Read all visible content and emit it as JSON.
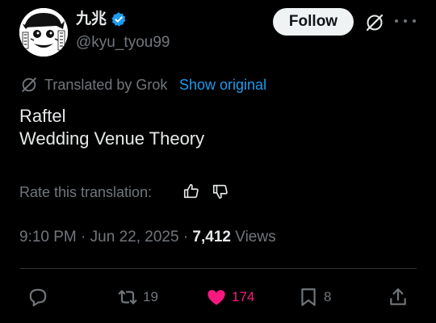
{
  "author": {
    "display_name": "九兆",
    "handle": "@kyu_tyou99",
    "verified": true
  },
  "header": {
    "follow_label": "Follow",
    "icons": [
      "grok-icon",
      "more-icon"
    ]
  },
  "translation": {
    "label": "Translated by Grok",
    "show_original": "Show original"
  },
  "tweet": {
    "lines": [
      "Raftel",
      "Wedding Venue Theory"
    ]
  },
  "rating": {
    "label": "Rate this translation:",
    "icons": [
      "thumbs-up-icon",
      "thumbs-down-icon"
    ]
  },
  "meta": {
    "time": "9:10 PM",
    "separator": " · ",
    "date": "Jun 22, 2025",
    "views_count": "7,412",
    "views_label": "Views"
  },
  "actions": {
    "reply_count": "",
    "retweet_count": "19",
    "like_count": "174",
    "bookmark_count": "8"
  },
  "colors": {
    "background": "#000000",
    "text": "#e7e9ea",
    "secondary": "#71767b",
    "link": "#1d9bf0",
    "like": "#f91880",
    "verified": "#1d9bf0",
    "divider": "#2f3336"
  }
}
